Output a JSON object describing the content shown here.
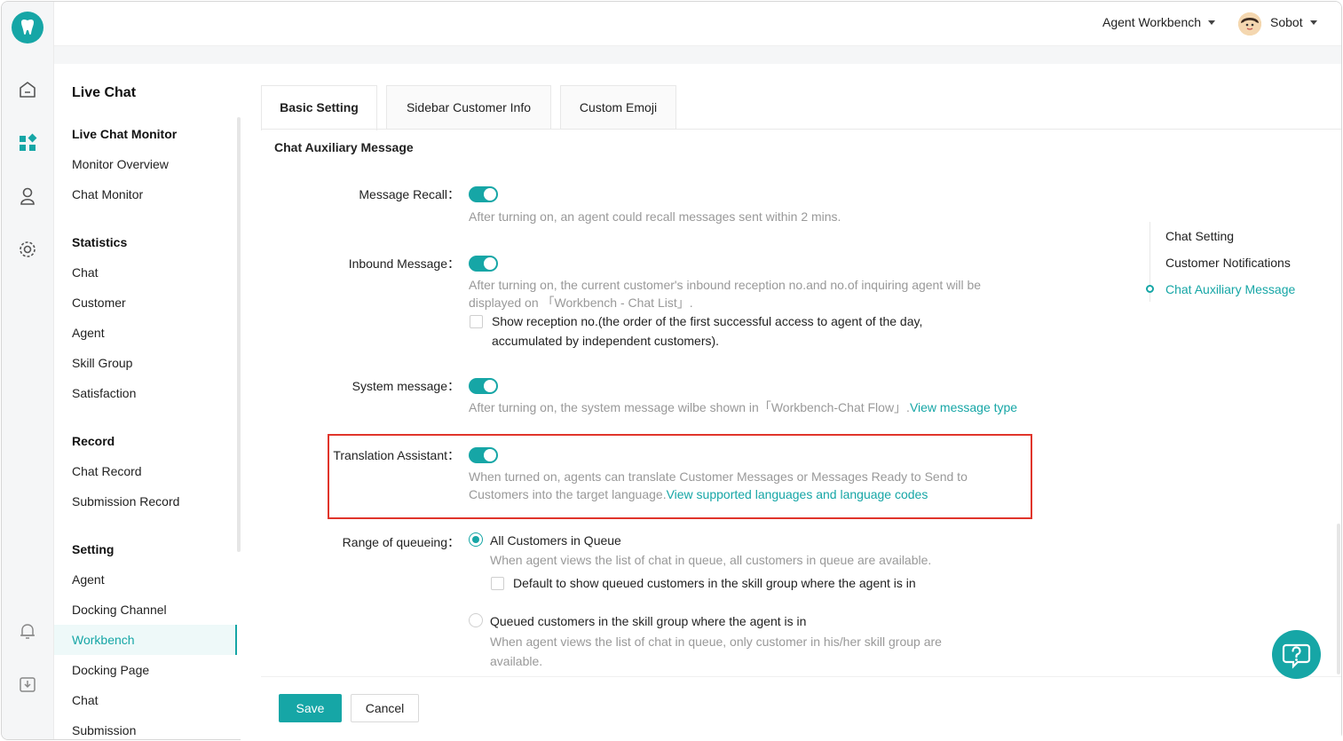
{
  "header": {
    "workspace_label": "Agent Workbench",
    "user_name": "Sobot"
  },
  "menu": {
    "title": "Live Chat",
    "items": [
      {
        "label": "Live Chat Monitor",
        "group": true
      },
      {
        "label": "Monitor Overview"
      },
      {
        "label": "Chat Monitor"
      },
      {
        "label": "Statistics",
        "group": true
      },
      {
        "label": "Chat"
      },
      {
        "label": "Customer"
      },
      {
        "label": "Agent"
      },
      {
        "label": "Skill Group"
      },
      {
        "label": "Satisfaction"
      },
      {
        "label": "Record",
        "group": true
      },
      {
        "label": "Chat Record"
      },
      {
        "label": "Submission Record"
      },
      {
        "label": "Setting",
        "group": true
      },
      {
        "label": "Agent"
      },
      {
        "label": "Docking Channel"
      },
      {
        "label": "Workbench",
        "active": true
      },
      {
        "label": "Docking Page"
      },
      {
        "label": "Chat"
      },
      {
        "label": "Submission"
      }
    ]
  },
  "tabs": [
    {
      "label": "Basic Setting",
      "active": true
    },
    {
      "label": "Sidebar Customer Info"
    },
    {
      "label": "Custom Emoji"
    }
  ],
  "section_title": "Chat Auxiliary Message",
  "settings": {
    "message_recall": {
      "label": "Message Recall",
      "enabled": true,
      "desc": "After turning on, an agent could recall messages sent within 2 mins."
    },
    "inbound_message": {
      "label": "Inbound Message",
      "enabled": true,
      "desc_line1": "After turning on, the current customer's inbound reception no.and no.of inquiring agent will be",
      "desc_line2": "displayed on 「Workbench - Chat List」.",
      "checkbox_line1": "Show reception no.(the order of the first successful access to agent of the day,",
      "checkbox_line2": "accumulated by independent customers)."
    },
    "system_message": {
      "label": "System message",
      "enabled": true,
      "desc": "After turning on, the system message wilbe shown in「Workbench-Chat Flow」.",
      "link": "View message type"
    },
    "translation_assistant": {
      "label": "Translation Assistant",
      "enabled": true,
      "desc_line1": "When turned on, agents can translate Customer Messages or Messages Ready to Send to",
      "desc_line2": "Customers into the target language.",
      "link": "View supported languages and language codes"
    },
    "range_of_queueing": {
      "label": "Range of queueing",
      "option1": "All Customers in Queue",
      "option1_desc": "When agent views the list of chat in queue, all customers in queue are available.",
      "option1_checkbox": "Default to show queued customers in the skill group where the agent is in",
      "option2": "Queued customers in the skill group where the agent is in",
      "option2_desc_line1": "When agent views the list of chat in queue, only customer in his/her skill group are",
      "option2_desc_line2": "available."
    }
  },
  "anchors": [
    {
      "label": "Chat Setting"
    },
    {
      "label": "Customer Notifications"
    },
    {
      "label": "Chat Auxiliary Message",
      "active": true
    }
  ],
  "footer": {
    "save": "Save",
    "cancel": "Cancel"
  },
  "colors": {
    "accent": "#16a6a6",
    "highlight_border": "#e0352b"
  }
}
